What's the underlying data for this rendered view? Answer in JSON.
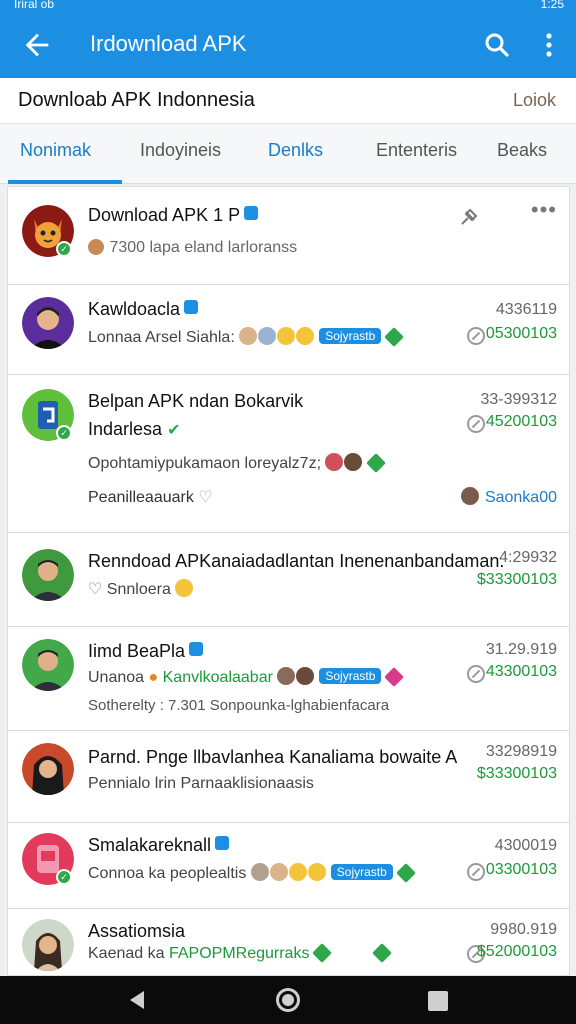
{
  "status": {
    "left": "Iriral ob",
    "right": "1:25"
  },
  "appbar": {
    "title": "Irdownload APK"
  },
  "subheader": {
    "title": "Downloab APK Indonnesia",
    "action": "Loiok"
  },
  "tabs": [
    "Nonimak",
    "Indoyineis",
    "Denlks",
    "Ententeris",
    "Beaks"
  ],
  "colors": {
    "primary": "#1c8fe3",
    "green": "#1a9a3a",
    "active_tab": "#1a7cc9"
  },
  "rows": [
    {
      "name": "Download APK 1 P",
      "sub": "7300 lapa eland larloranss",
      "avatar": "cat-orange"
    },
    {
      "name": "Kawldoacla",
      "sub": "Lonnaa Arsel Siahla:",
      "tag": "Sojyrastb",
      "top": "4336119",
      "bottom": "05300103",
      "avatar": "man-purple"
    },
    {
      "name": "Belpan APK ndan Bokarvik",
      "name2": "Indarlesa",
      "sub": "Opohtamiypukamaon loreyalz7z;",
      "sub3": "Peanilleaauark",
      "top": "33-399312",
      "bottom": "45200103",
      "user": "Saonka00",
      "avatar": "app-green"
    },
    {
      "name": "Renndoad APKanaiadadlantan Inenenanbandaman.",
      "sub": "Snnloera",
      "top": "4:29932",
      "bottom": "$33300103",
      "avatar": "man-suit"
    },
    {
      "name": "Iimd BeaPla",
      "sub": "Unanoa",
      "sub_green": "Kanvlkoalaabar",
      "tag": "Sojyrastb",
      "sub3": "Sotherelty : 7.301 Sonpounka-lghabienfacara",
      "top": "31.29.919",
      "bottom": "43300103",
      "avatar": "man-green"
    },
    {
      "name": "Parnd. Pnge llbavlanhea Kanaliama bowaite A",
      "sub": "Pennialo lrin Parnaaklisionaasis",
      "top": "33298919",
      "bottom": "$33300103",
      "avatar": "woman-dark"
    },
    {
      "name": "Smalakareknall",
      "sub": "Connoa ka peoplealtis",
      "tag": "Sojyrastb",
      "top": "4300019",
      "bottom": "03300103",
      "avatar": "app-pink"
    },
    {
      "name": "Assatiomsia",
      "sub": "Kaenad ka",
      "sub_green": "FAPOPMRegurraks",
      "top": "9980.919",
      "bottom": "$52000103",
      "avatar": "woman-light"
    }
  ]
}
